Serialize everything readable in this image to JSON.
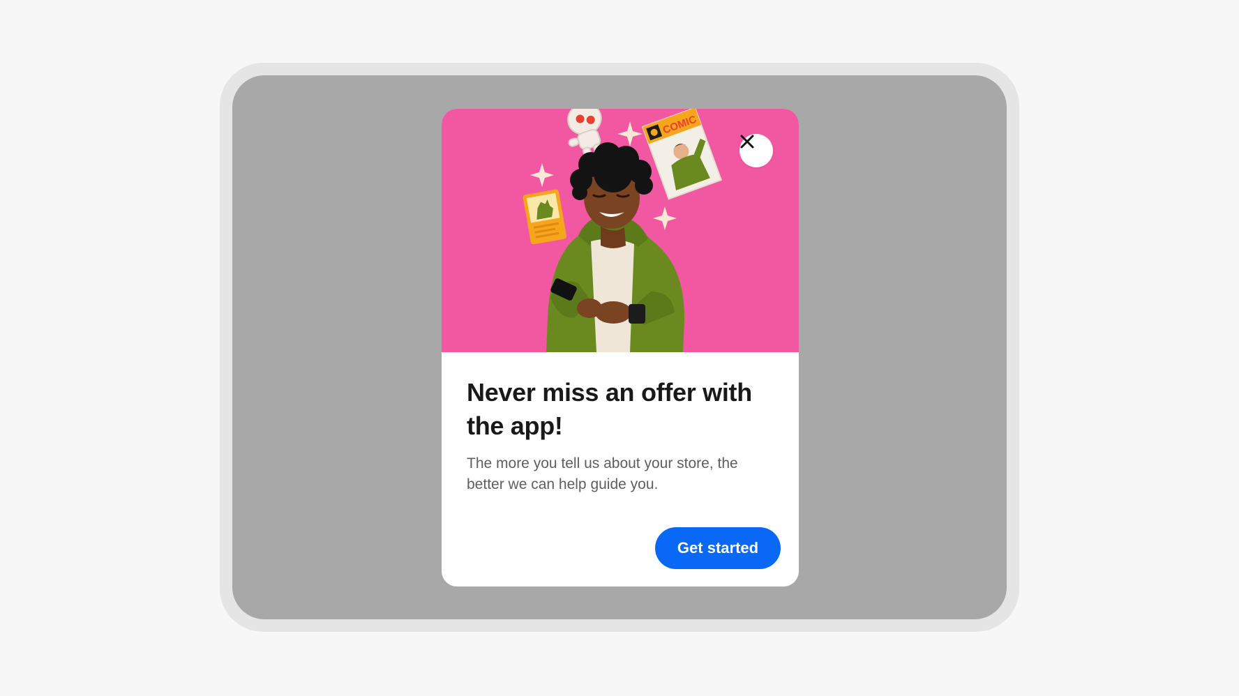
{
  "modal": {
    "title": "Never miss an offer with the app!",
    "description": "The more you tell us about your store, the better we can help guide you.",
    "cta_label": "Get started",
    "close_icon": "close-icon",
    "hero_background": "#f257a1",
    "cta_color": "#0968f6"
  },
  "illustration": {
    "comic_label": "COMIC",
    "elements": [
      "person-with-phone",
      "astronaut-figure",
      "comic-book",
      "trading-card",
      "sparkle"
    ]
  }
}
